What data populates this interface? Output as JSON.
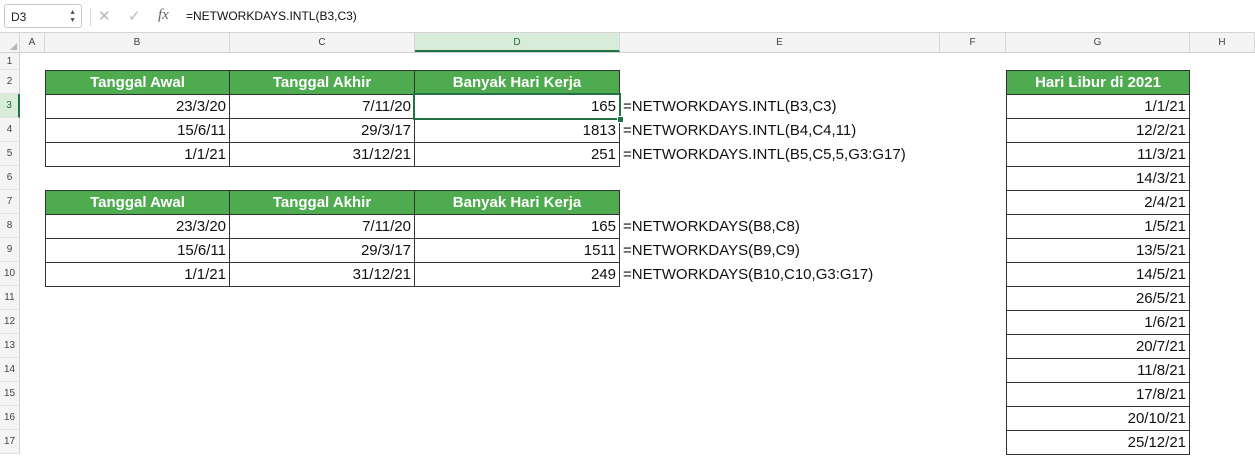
{
  "formula_bar": {
    "name_box": "D3",
    "cancel_glyph": "✕",
    "enter_glyph": "✓",
    "fx_glyph": "fx",
    "formula": "=NETWORKDAYS.INTL(B3,C3)"
  },
  "columns": [
    "A",
    "B",
    "C",
    "D",
    "E",
    "F",
    "G",
    "H"
  ],
  "rows": [
    "1",
    "2",
    "3",
    "4",
    "5",
    "6",
    "7",
    "8",
    "9",
    "10",
    "11",
    "12",
    "13",
    "14",
    "15",
    "16",
    "17"
  ],
  "table1": {
    "headers": [
      "Tanggal Awal",
      "Tanggal Akhir",
      "Banyak Hari Kerja"
    ],
    "rows": [
      [
        "23/3/20",
        "7/11/20",
        "165"
      ],
      [
        "15/6/11",
        "29/3/17",
        "1813"
      ],
      [
        "1/1/21",
        "31/12/21",
        "251"
      ]
    ],
    "formulas": [
      "=NETWORKDAYS.INTL(B3,C3)",
      "=NETWORKDAYS.INTL(B4,C4,11)",
      "=NETWORKDAYS.INTL(B5,C5,5,G3:G17)"
    ]
  },
  "table2": {
    "headers": [
      "Tanggal Awal",
      "Tanggal Akhir",
      "Banyak Hari Kerja"
    ],
    "rows": [
      [
        "23/3/20",
        "7/11/20",
        "165"
      ],
      [
        "15/6/11",
        "29/3/17",
        "1511"
      ],
      [
        "1/1/21",
        "31/12/21",
        "249"
      ]
    ],
    "formulas": [
      "=NETWORKDAYS(B8,C8)",
      "=NETWORKDAYS(B9,C9)",
      "=NETWORKDAYS(B10,C10,G3:G17)"
    ]
  },
  "holidays": {
    "header": "Hari Libur di 2021",
    "dates": [
      "1/1/21",
      "12/2/21",
      "11/3/21",
      "14/3/21",
      "2/4/21",
      "1/5/21",
      "13/5/21",
      "14/5/21",
      "26/5/21",
      "1/6/21",
      "20/7/21",
      "11/8/21",
      "17/8/21",
      "20/10/21",
      "25/12/21"
    ]
  },
  "colors": {
    "header_green": "#4fab4f",
    "selection_green": "#217346"
  }
}
